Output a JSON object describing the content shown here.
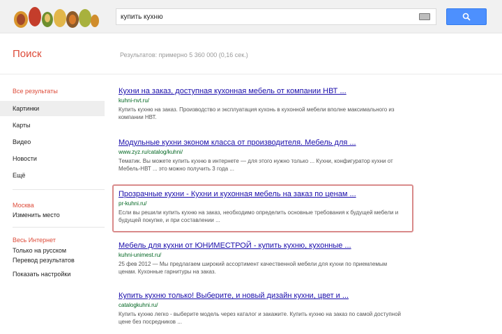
{
  "search": {
    "query": "купить кухню",
    "button_icon": "search-icon"
  },
  "header": {
    "section_title": "Поиск",
    "results_count": "Результатов: примерно 5 360 000 (0,16 сек.)"
  },
  "sidebar": {
    "items": [
      {
        "label": "Все результаты"
      },
      {
        "label": "Картинки"
      },
      {
        "label": "Карты"
      },
      {
        "label": "Видео"
      },
      {
        "label": "Новости"
      },
      {
        "label": "Ещё"
      }
    ],
    "location_title": "Москва",
    "location_change": "Изменить место",
    "time_title": "Весь Интернет",
    "time_items": [
      {
        "label": "Только на русском"
      },
      {
        "label": "Перевод результатов"
      },
      {
        "label": "Показать настройки"
      }
    ]
  },
  "results": [
    {
      "title": "Кухни на заказ, доступная кухонная мебель от компании НВТ ...",
      "url": "kuhni-nvt.ru/",
      "snippet": "Купить кухню на заказ. Производство и эксплуатация кухонь в кухонной мебели вполне максимального из компании НВТ."
    },
    {
      "title": "Модульные кухни эконом класса от производителя. Мебель для ...",
      "url": "www.zyz.ru/catalog/kuhni/",
      "snippet": "Тематик. Вы можете купить кухню в интернете — для этого нужно только ... Кухни, конфигуратор кухни от Мебель-НВТ ... это можно получить 3 года ..."
    },
    {
      "title": "Прозрачные кухни - Кухни и кухонная мебель на заказ по ценам ...",
      "url": "pr-kuhni.ru/",
      "snippet": "Если вы решили купить кухню на заказ, необходимо определить основные требования к будущей мебели и будущей покупке, и при составлении ..."
    },
    {
      "title": "Мебель для кухни от ЮНИМЕСТРОЙ - купить кухню, кухонные ...",
      "url": "kuhni-unimest.ru/",
      "snippet": "25 фев 2012 — Мы предлагаем широкий ассортимент качественной мебели для кухни по приемлемым ценам. Кухонные гарнитуры на заказ."
    },
    {
      "title": "Купить кухню только! Выберите, и новый дизайн кухни, цвет и ...",
      "url": "catalogkuhni.ru/",
      "snippet": "Купить кухню легко - выберите модель через каталог и закажите. Купить кухню на заказ по самой доступной цене без посредников ..."
    }
  ],
  "colors": {
    "accent_red": "#dd4b39",
    "link_blue": "#1a0dab",
    "url_green": "#006621",
    "button_blue": "#4d90fe"
  }
}
